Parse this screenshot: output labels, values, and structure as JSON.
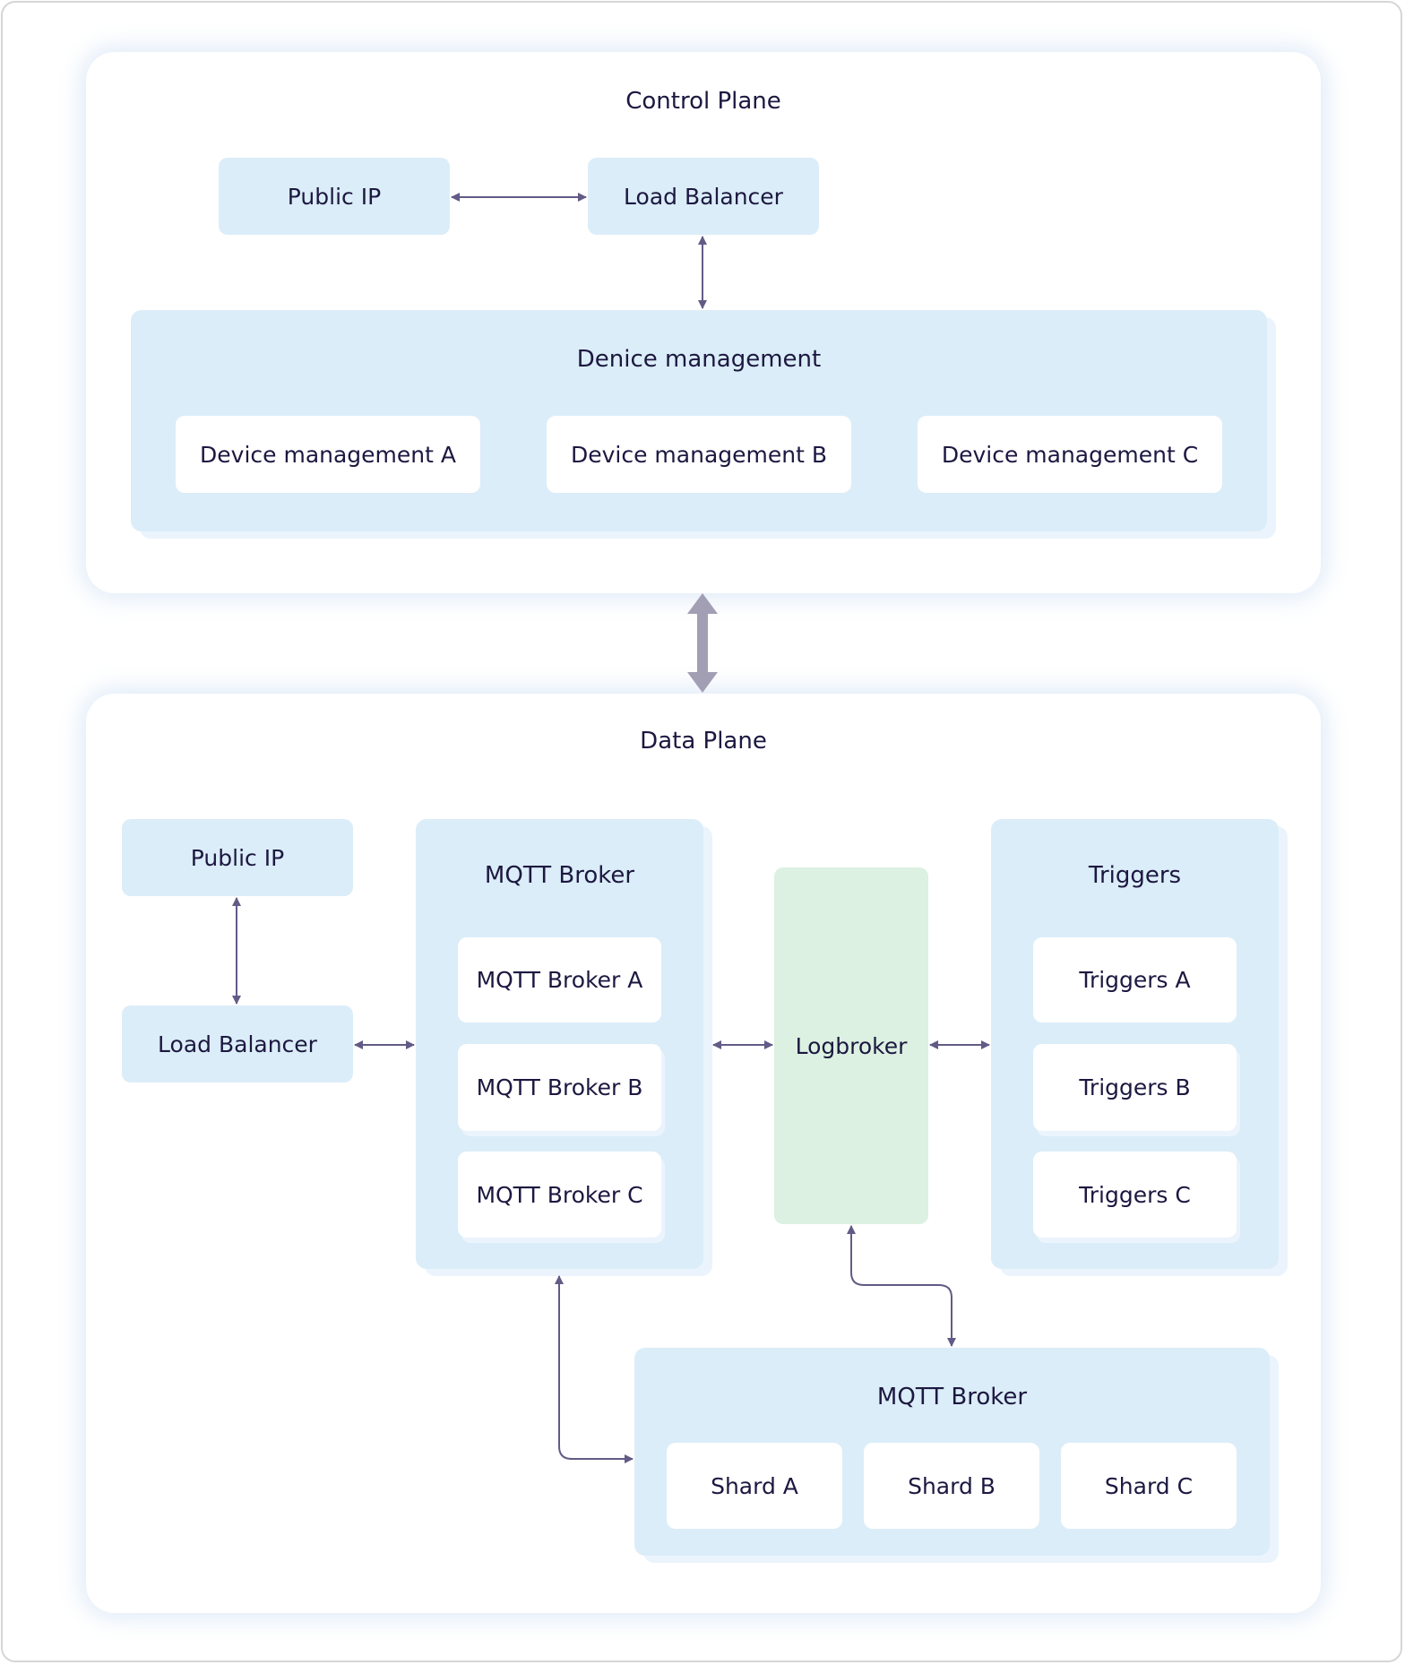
{
  "control_plane": {
    "title": "Control Plane",
    "public_ip": "Public IP",
    "load_balancer": "Load Balancer",
    "device_management": {
      "title": "Denice management",
      "items": [
        "Device management A",
        "Device management B",
        "Device management C"
      ]
    }
  },
  "data_plane": {
    "title": "Data Plane",
    "public_ip": "Public IP",
    "load_balancer": "Load Balancer",
    "mqtt_broker": {
      "title": "MQTT Broker",
      "items": [
        "MQTT Broker A",
        "MQTT Broker B",
        "MQTT Broker C"
      ]
    },
    "logbroker": "Logbroker",
    "triggers": {
      "title": "Triggers",
      "items": [
        "Triggers A",
        "Triggers B",
        "Triggers C"
      ]
    },
    "mqtt_shards": {
      "title": "MQTT Broker",
      "items": [
        "Shard A",
        "Shard B",
        "Shard C"
      ]
    }
  },
  "colors": {
    "box_blue": "#dbedf8",
    "box_green": "#dcf1e1",
    "arrow": "#625b86",
    "plane_arrow": "#a29fb5",
    "text": "#1c1840"
  }
}
